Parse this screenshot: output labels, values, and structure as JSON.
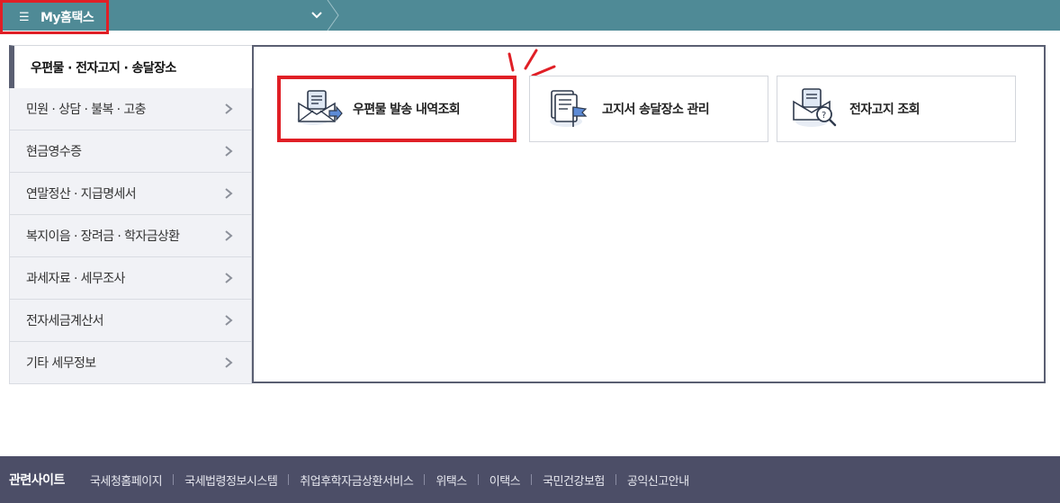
{
  "topbar": {
    "home_label": "My홈택스",
    "menu_icon": "hamburger-icon",
    "dropdown_icon": "chevron-down-icon"
  },
  "sidebar": {
    "active": "우편물 · 전자고지 · 송달장소",
    "items": [
      {
        "label": "민원 · 상담 · 불복 · 고충"
      },
      {
        "label": "현금영수증"
      },
      {
        "label": "연말정산 · 지급명세서"
      },
      {
        "label": "복지이음 · 장려금 · 학자금상환"
      },
      {
        "label": "과세자료 · 세무조사"
      },
      {
        "label": "전자세금계산서"
      },
      {
        "label": "기타 세무정보"
      }
    ]
  },
  "tiles": [
    {
      "label": "우편물 발송 내역조회",
      "icon": "mail-send-icon"
    },
    {
      "label": "고지서 송달장소 관리",
      "icon": "document-flag-icon"
    },
    {
      "label": "전자고지 조회",
      "icon": "mail-search-icon"
    }
  ],
  "footer": {
    "title": "관련사이트",
    "links": [
      "국세청홈페이지",
      "국세법령정보시스템",
      "취업후학자금상환서비스",
      "위택스",
      "이택스",
      "국민건강보험",
      "공익신고안내"
    ]
  },
  "colors": {
    "topbar": "#4f8a96",
    "highlight": "#e01f26",
    "footer": "#4c4e67",
    "panel_border": "#5a5f72"
  }
}
